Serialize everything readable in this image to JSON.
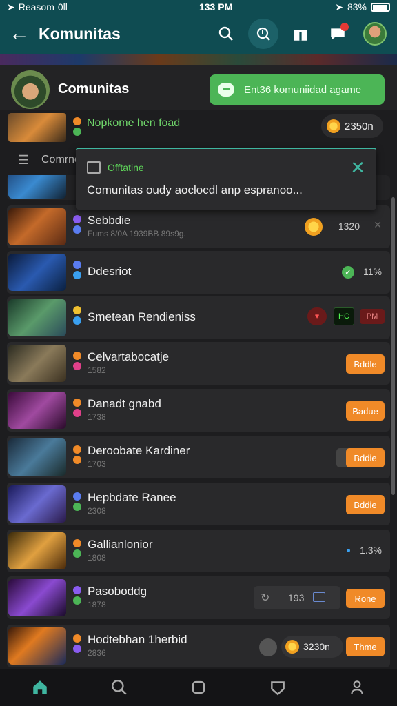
{
  "status_bar": {
    "carrier": "Reasom",
    "signal_text": "0ll",
    "time": "133 PM",
    "battery": "83%"
  },
  "app_bar": {
    "title": "Komunitas",
    "icons": [
      "back-arrow-icon",
      "search-icon",
      "search-history-icon",
      "gift-icon",
      "chat-icon",
      "avatar"
    ]
  },
  "community": {
    "title": "Comunitas",
    "join_label": "Ent36 komuniidad agame"
  },
  "featured": {
    "name": "Nopkome hen foad",
    "coins": "2350n"
  },
  "filter": {
    "label": "Comrno"
  },
  "toast": {
    "title": "Offtatine",
    "body": "Comunitas oudy aoclocdl anp espranoo..."
  },
  "rows": [
    {
      "name": "Sebbdie",
      "sub": "Fums 8/0A 1939BB 89s9g.",
      "value": "1320",
      "dots": [
        "#8a5cf0",
        "#5a7cf0"
      ]
    },
    {
      "name": "Ddesriot",
      "sub": "",
      "value": "11%",
      "dots": [
        "#5a7cf0",
        "#3aa0f0"
      ]
    },
    {
      "name": "Smetean Rendieniss",
      "sub": "",
      "tag1": "HC",
      "tag2": "PM",
      "dots": [
        "#f0c030",
        "#3aa0f0"
      ]
    },
    {
      "name": "Celvartabocatje",
      "sub": "1582",
      "button": "Bddle",
      "dots": [
        "#f08a28",
        "#e0408a"
      ]
    },
    {
      "name": "Danadt gnabd",
      "sub": "1738",
      "button": "Badue",
      "dots": [
        "#f08a28",
        "#e0408a"
      ]
    },
    {
      "name": "Deroobate Kardiner",
      "sub": "1703",
      "button": "Bddie",
      "dots": [
        "#f08a28",
        "#f08a28"
      ]
    },
    {
      "name": "Hepbdate Ranee",
      "sub": "2308",
      "button": "Bddie",
      "dots": [
        "#5a7cf0",
        "#4cb556"
      ]
    },
    {
      "name": "Gallianlonior",
      "sub": "1808",
      "value": "1.3%",
      "dots": [
        "#f08a28",
        "#4cb556"
      ]
    },
    {
      "name": "Pasoboddg",
      "sub": "1878",
      "value": "193",
      "button": "Rone",
      "dots": [
        "#8a5cf0",
        "#4cb556"
      ]
    },
    {
      "name": "Hodtebhan 1herbid",
      "sub": "2836",
      "value": "3230n",
      "button": "Thme",
      "dots": [
        "#f08a28",
        "#8a5cf0"
      ]
    }
  ],
  "bottom_nav": [
    "home-icon",
    "search-icon",
    "square-icon",
    "shield-icon",
    "profile-icon"
  ]
}
